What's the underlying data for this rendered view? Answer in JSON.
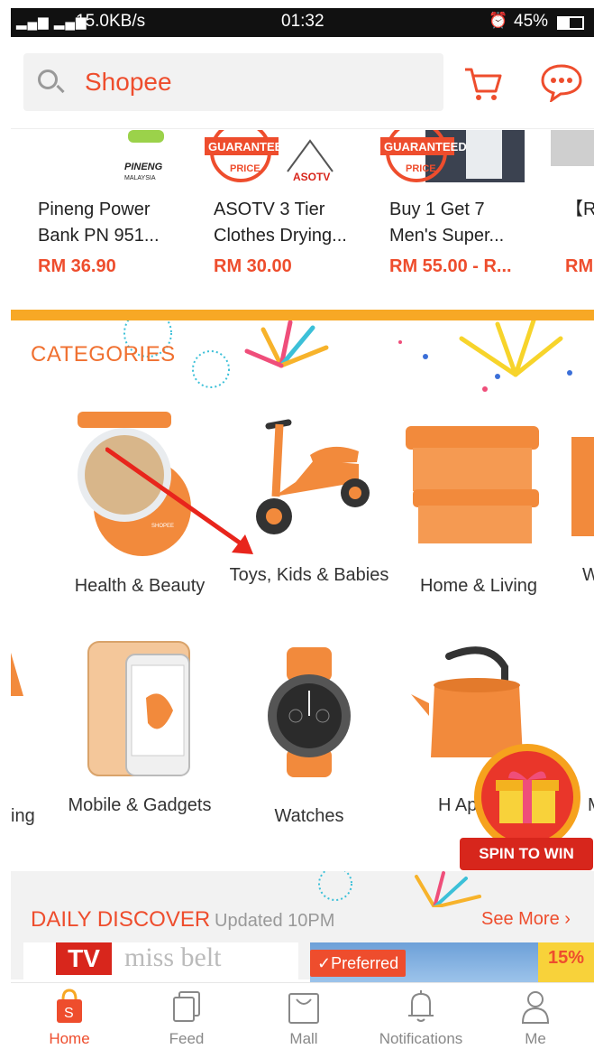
{
  "status_bar": {
    "network_speed": "15.0KB/s",
    "time": "01:32",
    "battery": "45%",
    "battery_level": 0.45
  },
  "header": {
    "search_placeholder": "Shopee",
    "icons": [
      "search-icon",
      "cart-icon",
      "chat-icon"
    ]
  },
  "products": [
    {
      "name": "Pineng Power Bank PN 951...",
      "price": "RM 36.90",
      "brand_text": "PINENG",
      "brand_sub": "MALAYSIA"
    },
    {
      "name": "ASOTV 3 Tier Clothes Drying...",
      "price": "RM 30.00",
      "badge": "GUARANTEED",
      "badge_sub": "PRICE",
      "brand_text": "ASOTV"
    },
    {
      "name": "Buy 1 Get 7 Men's Super...",
      "price": "RM 55.00 - R...",
      "badge": "GUARANTEED",
      "badge_sub": "PRICE"
    },
    {
      "name": "【R CRY",
      "price": "RM"
    }
  ],
  "categories": {
    "title": "CATEGORIES",
    "row1": [
      {
        "label": "Health & Beauty"
      },
      {
        "label": "Toys, Kids & Babies"
      },
      {
        "label": "Home & Living"
      },
      {
        "label": "W"
      }
    ],
    "row2": [
      {
        "label": "ing"
      },
      {
        "label": "Mobile & Gadgets"
      },
      {
        "label": "Watches"
      },
      {
        "label": "H App"
      },
      {
        "label": "M"
      }
    ]
  },
  "spin": {
    "label": "SPIN TO WIN"
  },
  "daily_discover": {
    "title": "DAILY DISCOVER",
    "updated": "Updated 10PM",
    "see_more": "See More",
    "tiles": [
      {
        "logo": "TV",
        "brand": "miss belt"
      },
      {
        "tag": "✓Preferred",
        "discount": "15%"
      }
    ]
  },
  "bottom_nav": [
    {
      "label": "Home",
      "icon": "home-bag-icon",
      "active": true
    },
    {
      "label": "Feed",
      "icon": "feed-icon",
      "active": false
    },
    {
      "label": "Mall",
      "icon": "mall-bag-icon",
      "active": false
    },
    {
      "label": "Notifications",
      "icon": "bell-icon",
      "active": false
    },
    {
      "label": "Me",
      "icon": "person-icon",
      "active": false
    }
  ],
  "colors": {
    "accent": "#ee4d2d",
    "category_orange": "#f07030",
    "band": "#f7a825",
    "product_orange": "#f28a3c"
  }
}
